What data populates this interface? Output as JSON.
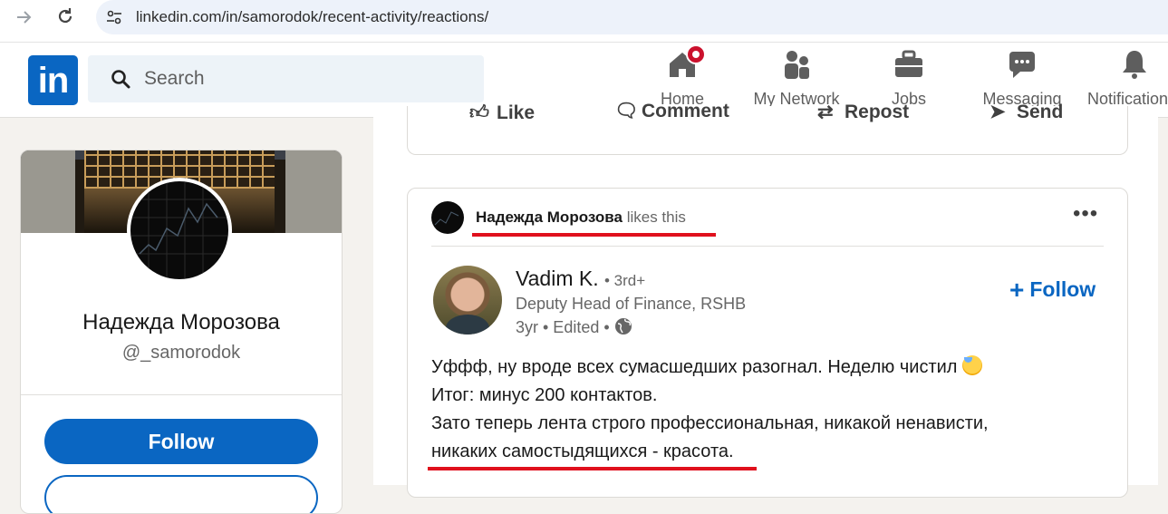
{
  "browser": {
    "url": "linkedin.com/in/samorodok/recent-activity/reactions/"
  },
  "header": {
    "logo_text": "in",
    "search_placeholder": "Search",
    "nav": [
      {
        "label": "Home",
        "icon": "home-icon"
      },
      {
        "label": "My Network",
        "icon": "network-icon"
      },
      {
        "label": "Jobs",
        "icon": "briefcase-icon"
      },
      {
        "label": "Messaging",
        "icon": "messaging-icon"
      },
      {
        "label": "Notifications",
        "icon": "bell-icon"
      }
    ]
  },
  "profile": {
    "name": "Надежда Морозова",
    "handle": "@_samorodok",
    "follow_label": "Follow"
  },
  "previous_post_actions": {
    "like": "Like",
    "comment": "Comment",
    "repost": "Repost",
    "send": "Send"
  },
  "post": {
    "reactor_name": "Надежда Морозова",
    "reactor_action": "likes this",
    "author": {
      "name": "Vadim K.",
      "degree": "• 3rd+",
      "title": "Deputy Head of Finance, RSHB",
      "meta": "3yr • Edited •"
    },
    "follow_label": "Follow",
    "text_lines": [
      "Уффф, ну вроде всех сумасшедших разогнал. Неделю чистил",
      "Итог: минус 200 контактов.",
      "Зато теперь лента строго профессиональная, никакой ненависти,",
      "никаких самостыдящихся - красота."
    ]
  },
  "colors": {
    "linkedin_blue": "#0a66c2",
    "annotation_red": "#e0101d",
    "notification_red": "#cb112d"
  }
}
